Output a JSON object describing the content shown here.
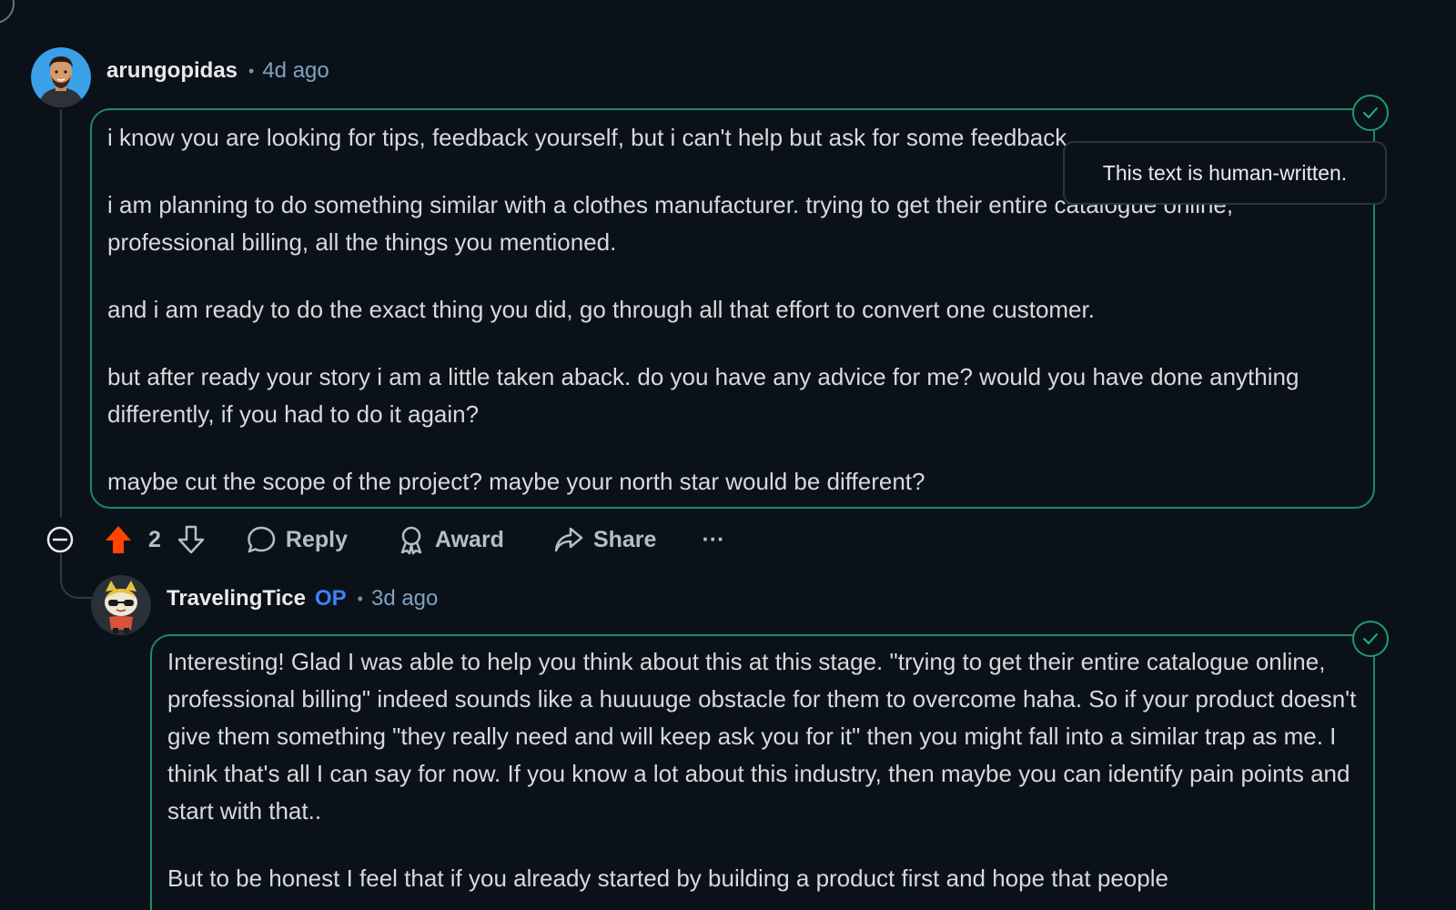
{
  "comment1": {
    "username": "arungopidas",
    "separator": "•",
    "time": "4d ago",
    "paragraphs": [
      "i know you are looking for tips, feedback yourself, but i can't help but ask for some feedback",
      "i am planning to do something similar with a clothes manufacturer. trying to get their entire catalogue online, professional billing, all the things you mentioned.",
      "and i am ready to do the exact thing you did, go through all that effort to convert one customer.",
      "but after ready your story i am a little taken aback. do you have any advice for me? would you have done anything differently, if you had to do it again?",
      "maybe cut the scope of the project? maybe your north star would be different?"
    ],
    "badge_icon": "check-icon"
  },
  "tooltip": {
    "text": "This text is human-written."
  },
  "actions": {
    "collapse_icon": "minus-circle-icon",
    "upvote_icon": "arrow-up-icon",
    "vote_count": "2",
    "downvote_icon": "arrow-down-icon",
    "reply_label": "Reply",
    "award_label": "Award",
    "share_label": "Share",
    "more_label": "···"
  },
  "comment2": {
    "username": "TravelingTice",
    "op_tag": "OP",
    "separator": "•",
    "time": "3d ago",
    "paragraphs": [
      "Interesting! Glad I was able to help you think about this at this stage. \"trying to get their entire catalogue online, professional billing\" indeed sounds like a huuuuge obstacle for them to overcome haha. So if your product doesn't give them something \"they really need and will keep ask you for it\" then you might fall into a similar trap as me. I think that's all I can say for now. If you know a lot about this industry, then maybe you can identify pain points and start with that..",
      "But to be honest I feel that if you already started by building a product first and hope that people"
    ],
    "badge_icon": "check-icon"
  },
  "colors": {
    "background": "#0b1118",
    "border_green": "#1f8a63",
    "upvote_active": "#ff4500",
    "op_blue": "#3d82f5",
    "time_blue": "#7da2c3"
  }
}
